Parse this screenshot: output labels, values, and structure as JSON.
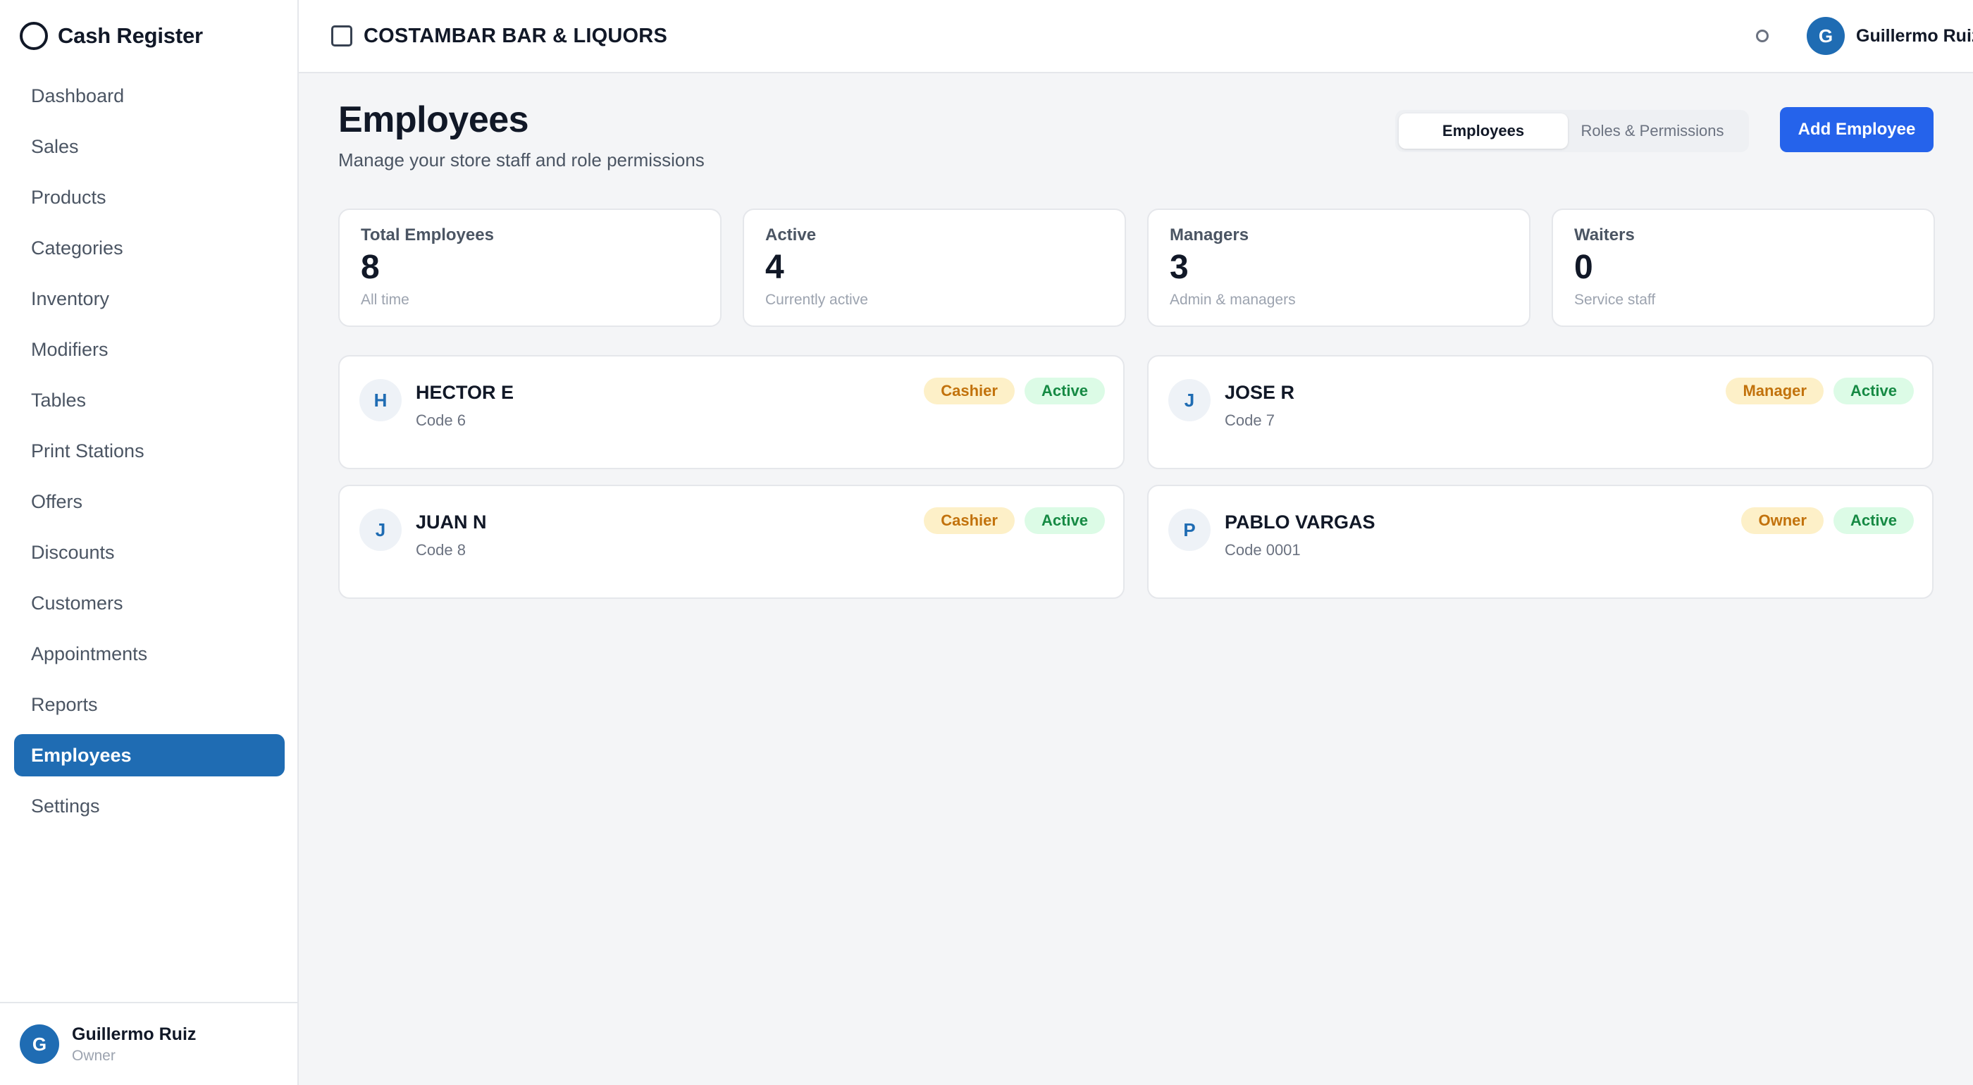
{
  "app": {
    "title": "Cash Register"
  },
  "sidebar": {
    "items": [
      {
        "label": "Dashboard",
        "key": "dashboard"
      },
      {
        "label": "Sales",
        "key": "sales"
      },
      {
        "label": "Products",
        "key": "products"
      },
      {
        "label": "Categories",
        "key": "categories"
      },
      {
        "label": "Inventory",
        "key": "inventory"
      },
      {
        "label": "Modifiers",
        "key": "modifiers"
      },
      {
        "label": "Tables",
        "key": "tables"
      },
      {
        "label": "Print Stations",
        "key": "print-stations"
      },
      {
        "label": "Offers",
        "key": "offers"
      },
      {
        "label": "Discounts",
        "key": "discounts"
      },
      {
        "label": "Customers",
        "key": "customers"
      },
      {
        "label": "Appointments",
        "key": "appointments"
      },
      {
        "label": "Reports",
        "key": "reports"
      },
      {
        "label": "Employees",
        "key": "employees",
        "active": true
      },
      {
        "label": "Settings",
        "key": "settings"
      }
    ],
    "user": {
      "initial": "G",
      "name": "Guillermo Ruiz",
      "role": "Owner"
    }
  },
  "header": {
    "store_name": "COSTAMBAR BAR & LIQUORS",
    "user": {
      "initial": "G",
      "name": "Guillermo Ruiz"
    }
  },
  "main": {
    "title": "Employees",
    "subtitle": "Manage your store staff and role permissions",
    "tabs": [
      {
        "label": "Employees",
        "active": true
      },
      {
        "label": "Roles & Permissions",
        "active": false
      }
    ],
    "add_button": "Add Employee",
    "stats": [
      {
        "label": "Total Employees",
        "value": "8",
        "sub": "All time"
      },
      {
        "label": "Active",
        "value": "4",
        "sub": "Currently active"
      },
      {
        "label": "Managers",
        "value": "3",
        "sub": "Admin & managers"
      },
      {
        "label": "Waiters",
        "value": "0",
        "sub": "Service staff"
      }
    ],
    "employees": [
      {
        "initial": "H",
        "name": "HECTOR E",
        "code": "Code 6",
        "role": "Cashier",
        "status": "Active"
      },
      {
        "initial": "J",
        "name": "JOSE R",
        "code": "Code 7",
        "role": "Manager",
        "status": "Active"
      },
      {
        "initial": "J",
        "name": "JUAN N",
        "code": "Code 8",
        "role": "Cashier",
        "status": "Active"
      },
      {
        "initial": "P",
        "name": "PABLO VARGAS",
        "code": "Code 0001",
        "role": "Owner",
        "status": "Active"
      }
    ]
  },
  "colors": {
    "accent": "#2563eb",
    "nav_active": "#1f6cb3",
    "badge_role_bg": "#fdf0c8",
    "badge_role_text": "#c2720c",
    "badge_status_bg": "#dcfbe6",
    "badge_status_text": "#168a44"
  }
}
